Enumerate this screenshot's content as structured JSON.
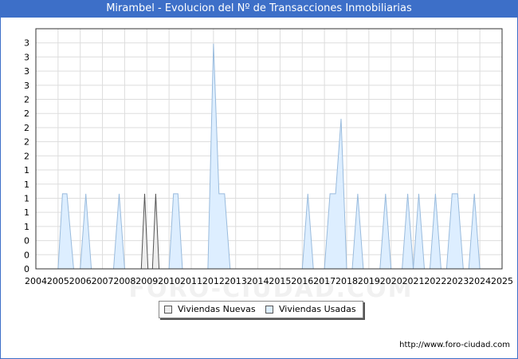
{
  "title": "Mirambel - Evolucion del Nº de Transacciones Inmobiliarias",
  "watermark": "FORO-CIUDAD.COM",
  "footer_url": "http://www.foro-ciudad.com",
  "colors": {
    "title_bg": "#3d6fc8",
    "nuevas_fill": "#eeeeee",
    "nuevas_line": "#555555",
    "usadas_fill": "#ddeeff",
    "usadas_line": "#99bbdd",
    "grid": "#dddddd"
  },
  "chart_data": {
    "type": "area",
    "title": "Mirambel - Evolucion del Nº de Transacciones Inmobiliarias",
    "xlabel": "",
    "ylabel": "",
    "xlim": [
      2004,
      2025
    ],
    "ylim": [
      0,
      3.2
    ],
    "x_ticks": [
      "2004",
      "2005",
      "2006",
      "2007",
      "2008",
      "2009",
      "2010",
      "2011",
      "2012",
      "2013",
      "2014",
      "2015",
      "2016",
      "2017",
      "2018",
      "2019",
      "2020",
      "2021",
      "2022",
      "2023",
      "2024",
      "2025"
    ],
    "y_ticks": [
      "0",
      "0",
      "0",
      "1",
      "1",
      "1",
      "1",
      "1",
      "2",
      "2",
      "2",
      "2",
      "2",
      "3",
      "3",
      "3",
      "3"
    ],
    "grid": true,
    "legend_position": "bottom",
    "series": [
      {
        "name": "Viviendas Nuevas",
        "points": [
          [
            2008.75,
            0
          ],
          [
            2008.9,
            1
          ],
          [
            2009.05,
            0
          ],
          [
            2009.25,
            0
          ],
          [
            2009.4,
            1
          ],
          [
            2009.55,
            0
          ]
        ]
      },
      {
        "name": "Viviendas Usadas",
        "points": [
          [
            2005.0,
            0
          ],
          [
            2005.2,
            1
          ],
          [
            2005.4,
            1
          ],
          [
            2005.7,
            0
          ],
          [
            2006.0,
            0
          ],
          [
            2006.25,
            1
          ],
          [
            2006.5,
            0
          ],
          [
            2007.5,
            0
          ],
          [
            2007.75,
            1
          ],
          [
            2008.0,
            0
          ],
          [
            2010.0,
            0
          ],
          [
            2010.2,
            1
          ],
          [
            2010.4,
            1
          ],
          [
            2010.6,
            0
          ],
          [
            2011.75,
            0
          ],
          [
            2012.0,
            3
          ],
          [
            2012.25,
            1
          ],
          [
            2012.5,
            1
          ],
          [
            2012.75,
            0
          ],
          [
            2016.0,
            0
          ],
          [
            2016.25,
            1
          ],
          [
            2016.5,
            0
          ],
          [
            2017.0,
            0
          ],
          [
            2017.25,
            1
          ],
          [
            2017.5,
            1
          ],
          [
            2017.75,
            2
          ],
          [
            2018.0,
            0
          ],
          [
            2018.25,
            0
          ],
          [
            2018.5,
            1
          ],
          [
            2018.75,
            0
          ],
          [
            2019.5,
            0
          ],
          [
            2019.75,
            1
          ],
          [
            2020.0,
            0
          ],
          [
            2020.5,
            0
          ],
          [
            2020.75,
            1
          ],
          [
            2021.0,
            0
          ],
          [
            2021.0,
            0
          ],
          [
            2021.25,
            1
          ],
          [
            2021.5,
            0
          ],
          [
            2021.75,
            0
          ],
          [
            2022.0,
            1
          ],
          [
            2022.25,
            0
          ],
          [
            2022.5,
            0
          ],
          [
            2022.75,
            1
          ],
          [
            2023.0,
            1
          ],
          [
            2023.25,
            0
          ],
          [
            2023.5,
            0
          ],
          [
            2023.75,
            1
          ],
          [
            2024.0,
            0
          ]
        ]
      }
    ]
  }
}
